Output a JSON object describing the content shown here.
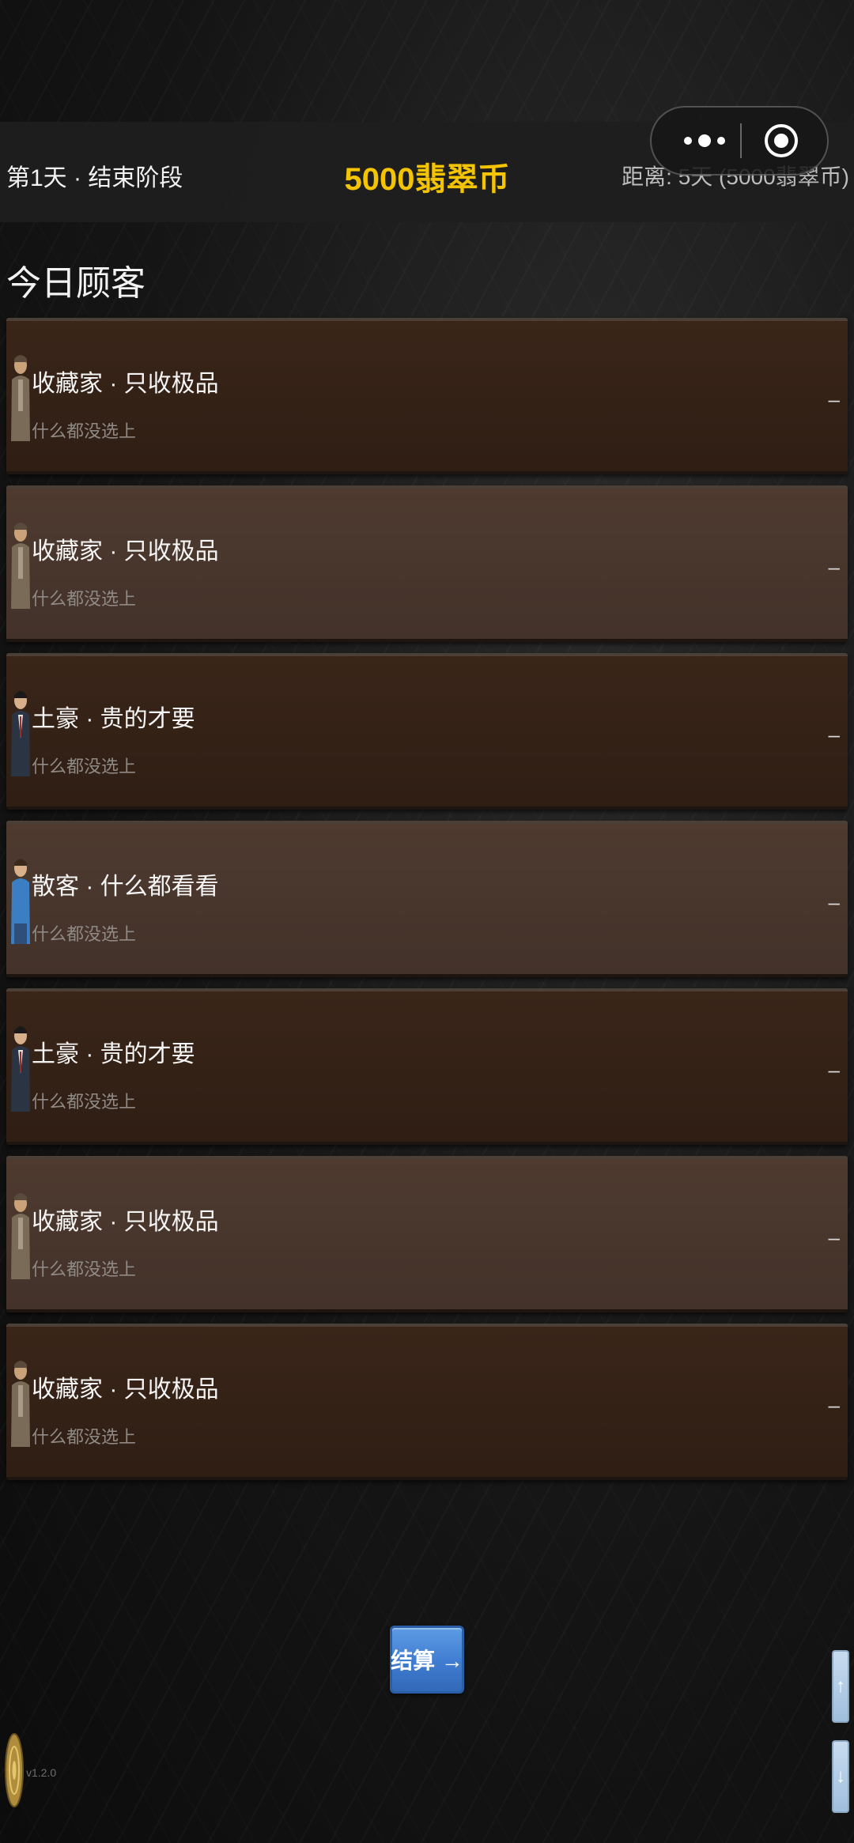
{
  "topbar": {
    "left_status": "第1天 · 结束阶段",
    "currency": "5000翡翠币",
    "right_status": "距离: 5天 (5000翡翠币)"
  },
  "capsule": {
    "menu_icon": "more-dots-icon",
    "close_icon": "target-circle-icon"
  },
  "section": {
    "title": "今日顾客"
  },
  "customers": [
    {
      "name": "收藏家 · 只收极品",
      "status": "什么都没选上",
      "avatar": "collector-portrait",
      "tone": "dark",
      "action": "–"
    },
    {
      "name": "收藏家 · 只收极品",
      "status": "什么都没选上",
      "avatar": "collector-portrait",
      "tone": "light",
      "action": "–"
    },
    {
      "name": "土豪 · 贵的才要",
      "status": "什么都没选上",
      "avatar": "rich-man-portrait",
      "tone": "dark",
      "action": "–"
    },
    {
      "name": "散客 · 什么都看看",
      "status": "什么都没选上",
      "avatar": "casual-customer-portrait",
      "tone": "light",
      "action": "–"
    },
    {
      "name": "土豪 · 贵的才要",
      "status": "什么都没选上",
      "avatar": "rich-man-portrait",
      "tone": "dark",
      "action": "–"
    },
    {
      "name": "收藏家 · 只收极品",
      "status": "什么都没选上",
      "avatar": "collector-portrait",
      "tone": "light",
      "action": "–"
    },
    {
      "name": "收藏家 · 只收极品",
      "status": "什么都没选上",
      "avatar": "collector-portrait",
      "tone": "dark",
      "action": "–"
    }
  ],
  "settle_button": {
    "label": "结算 →"
  },
  "scroll": {
    "up_label": "↑",
    "down_label": "↓"
  },
  "token": {
    "label": "v1.2.0",
    "icon": "gold-coin-icon"
  },
  "colors": {
    "currency": "#f5c400",
    "row_dark": "#34221a",
    "row_light": "#49362c",
    "button_blue": "#4a86d8"
  }
}
